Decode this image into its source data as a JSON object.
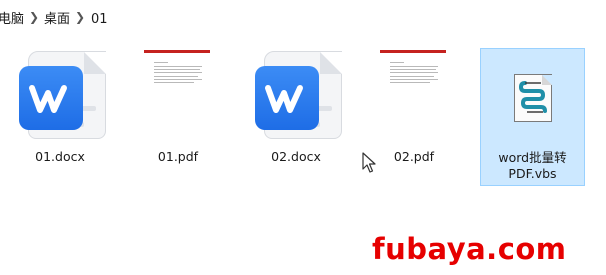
{
  "breadcrumb": {
    "items": [
      "电脑",
      "桌面",
      "01"
    ]
  },
  "files": [
    {
      "name": "01.docx",
      "type": "docx",
      "icon": "wps-writer-icon",
      "selected": false
    },
    {
      "name": "01.pdf",
      "type": "pdf",
      "icon": "pdf-thumbnail",
      "selected": false
    },
    {
      "name": "02.docx",
      "type": "docx",
      "icon": "wps-writer-icon",
      "selected": false
    },
    {
      "name": "02.pdf",
      "type": "pdf",
      "icon": "pdf-thumbnail",
      "selected": false
    },
    {
      "name_line1": "word批量转",
      "name_line2": "PDF.vbs",
      "type": "vbs",
      "icon": "vbs-script-icon",
      "selected": true
    }
  ],
  "watermark": "fubaya.com",
  "colors": {
    "selection_bg": "#cce8ff",
    "selection_border": "#99d1ff",
    "wps_blue": "#2878f0",
    "pdf_red": "#c5221f",
    "watermark_red": "#e60000"
  }
}
